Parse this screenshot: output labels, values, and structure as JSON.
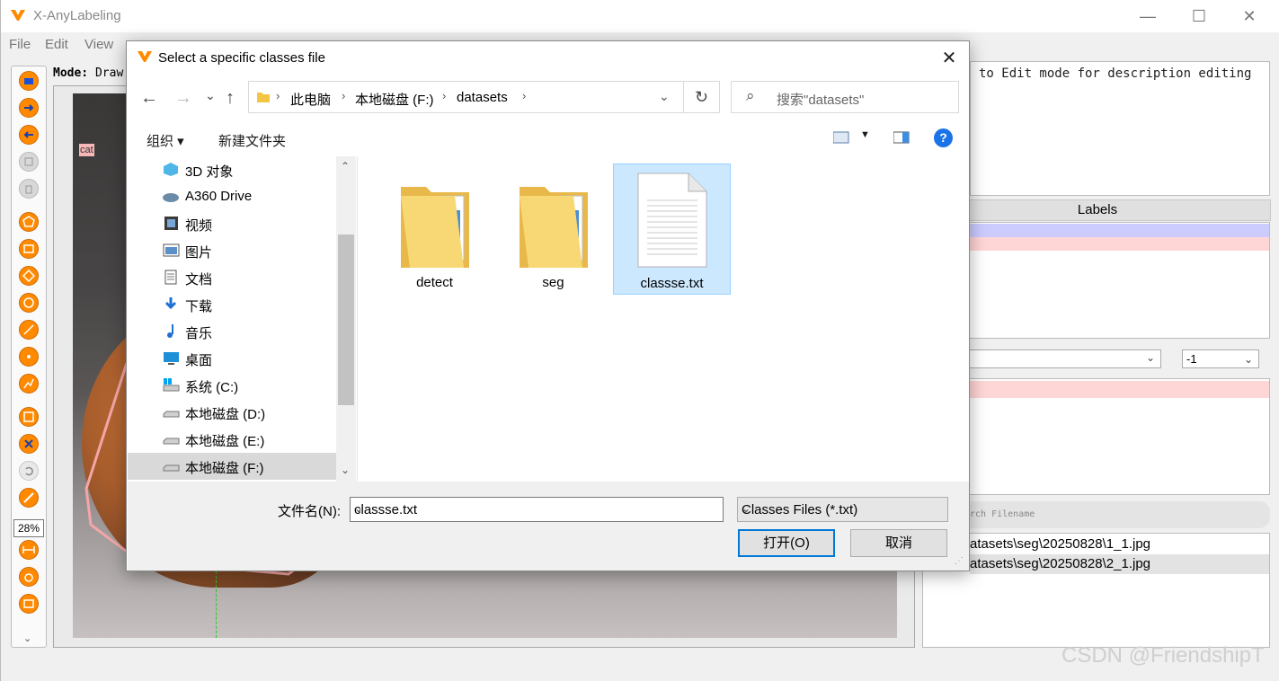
{
  "app": {
    "title": "X-AnyLabeling",
    "menu": [
      "File",
      "Edit",
      "View"
    ],
    "mode_label": "Mode:",
    "mode_value": " Draw",
    "zoom": "28%",
    "label_tag": "cat",
    "description_hint": "to Edit mode for description editing",
    "labels_header": "Labels",
    "group_id": "-1",
    "search_placeholder": "rch Filename",
    "files": [
      "atasets\\seg\\20250828\\1_1.jpg",
      "atasets\\seg\\20250828\\2_1.jpg"
    ],
    "watermark": "CSDN @FriendshipT",
    "accent_color": "#ff8a00"
  },
  "dialog": {
    "title": "Select a specific classes file",
    "breadcrumb": [
      "此电脑",
      "本地磁盘 (F:)",
      "datasets"
    ],
    "search_placeholder": "搜索\"datasets\"",
    "organize": "组织 ▾",
    "new_folder": "新建文件夹",
    "nav_items": [
      {
        "label": "3D 对象",
        "icon": "3d-objects-icon"
      },
      {
        "label": "A360 Drive",
        "icon": "cloud-drive-icon"
      },
      {
        "label": "视频",
        "icon": "video-icon"
      },
      {
        "label": "图片",
        "icon": "pictures-icon"
      },
      {
        "label": "文档",
        "icon": "documents-icon"
      },
      {
        "label": "下载",
        "icon": "downloads-icon"
      },
      {
        "label": "音乐",
        "icon": "music-icon"
      },
      {
        "label": "桌面",
        "icon": "desktop-icon"
      },
      {
        "label": "系统 (C:)",
        "icon": "system-drive-icon"
      },
      {
        "label": "本地磁盘 (D:)",
        "icon": "drive-icon"
      },
      {
        "label": "本地磁盘 (E:)",
        "icon": "drive-icon"
      },
      {
        "label": "本地磁盘 (F:)",
        "icon": "drive-icon"
      }
    ],
    "selected_nav": "本地磁盘 (F:)",
    "files": [
      {
        "name": "detect",
        "type": "folder"
      },
      {
        "name": "seg",
        "type": "folder"
      },
      {
        "name": "classse.txt",
        "type": "text-file",
        "selected": true
      }
    ],
    "filename_label": "文件名(N):",
    "filename_value": "classse.txt",
    "filetype": "Classes Files (*.txt)",
    "open_button": "打开(O)",
    "cancel_button": "取消"
  }
}
